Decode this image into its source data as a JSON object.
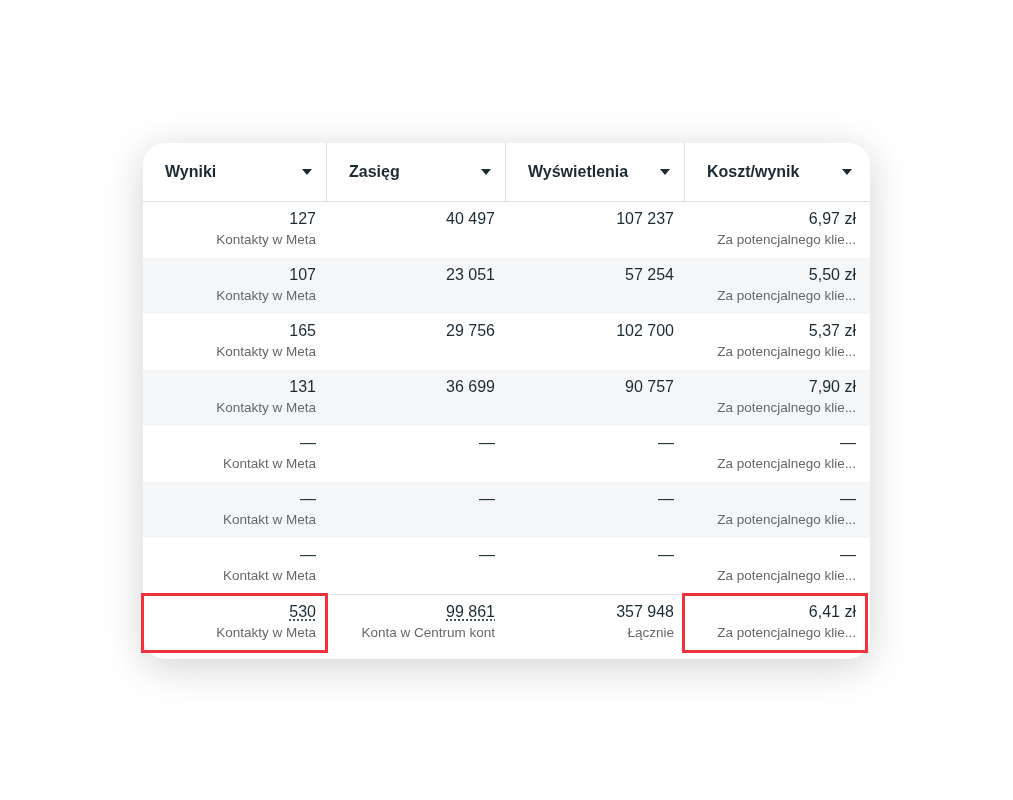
{
  "columns": [
    {
      "label": "Wyniki"
    },
    {
      "label": "Zasięg"
    },
    {
      "label": "Wyświetlenia"
    },
    {
      "label": "Koszt/wynik"
    }
  ],
  "rows": [
    {
      "cells": [
        {
          "value": "127",
          "sub": "Kontakty w Meta"
        },
        {
          "value": "40 497"
        },
        {
          "value": "107 237"
        },
        {
          "value": "6,97 zł",
          "sub": "Za potencjalnego klie..."
        }
      ]
    },
    {
      "cells": [
        {
          "value": "107",
          "sub": "Kontakty w Meta"
        },
        {
          "value": "23 051"
        },
        {
          "value": "57 254"
        },
        {
          "value": "5,50 zł",
          "sub": "Za potencjalnego klie..."
        }
      ]
    },
    {
      "cells": [
        {
          "value": "165",
          "sub": "Kontakty w Meta"
        },
        {
          "value": "29 756"
        },
        {
          "value": "102 700"
        },
        {
          "value": "5,37 zł",
          "sub": "Za potencjalnego klie..."
        }
      ]
    },
    {
      "cells": [
        {
          "value": "131",
          "sub": "Kontakty w Meta"
        },
        {
          "value": "36 699"
        },
        {
          "value": "90 757"
        },
        {
          "value": "7,90 zł",
          "sub": "Za potencjalnego klie..."
        }
      ]
    },
    {
      "cells": [
        {
          "value": "—",
          "sub": "Kontakt w Meta"
        },
        {
          "value": "—"
        },
        {
          "value": "—"
        },
        {
          "value": "—",
          "sub": "Za potencjalnego klie..."
        }
      ]
    },
    {
      "cells": [
        {
          "value": "—",
          "sub": "Kontakt w Meta"
        },
        {
          "value": "—"
        },
        {
          "value": "—"
        },
        {
          "value": "—",
          "sub": "Za potencjalnego klie..."
        }
      ]
    },
    {
      "cells": [
        {
          "value": "—",
          "sub": "Kontakt w Meta"
        },
        {
          "value": "—"
        },
        {
          "value": "—"
        },
        {
          "value": "—",
          "sub": "Za potencjalnego klie..."
        }
      ]
    }
  ],
  "total": {
    "cells": [
      {
        "value": "530",
        "sub": "Kontakty w Meta",
        "underlined": true,
        "highlighted": true
      },
      {
        "value": "99 861",
        "sub": "Konta w Centrum kont",
        "underlined": true,
        "highlighted": false
      },
      {
        "value": "357 948",
        "sub": "Łącznie",
        "underlined": false,
        "highlighted": false
      },
      {
        "value": "6,41 zł",
        "sub": "Za potencjalnego klie...",
        "underlined": false,
        "highlighted": true
      }
    ]
  }
}
